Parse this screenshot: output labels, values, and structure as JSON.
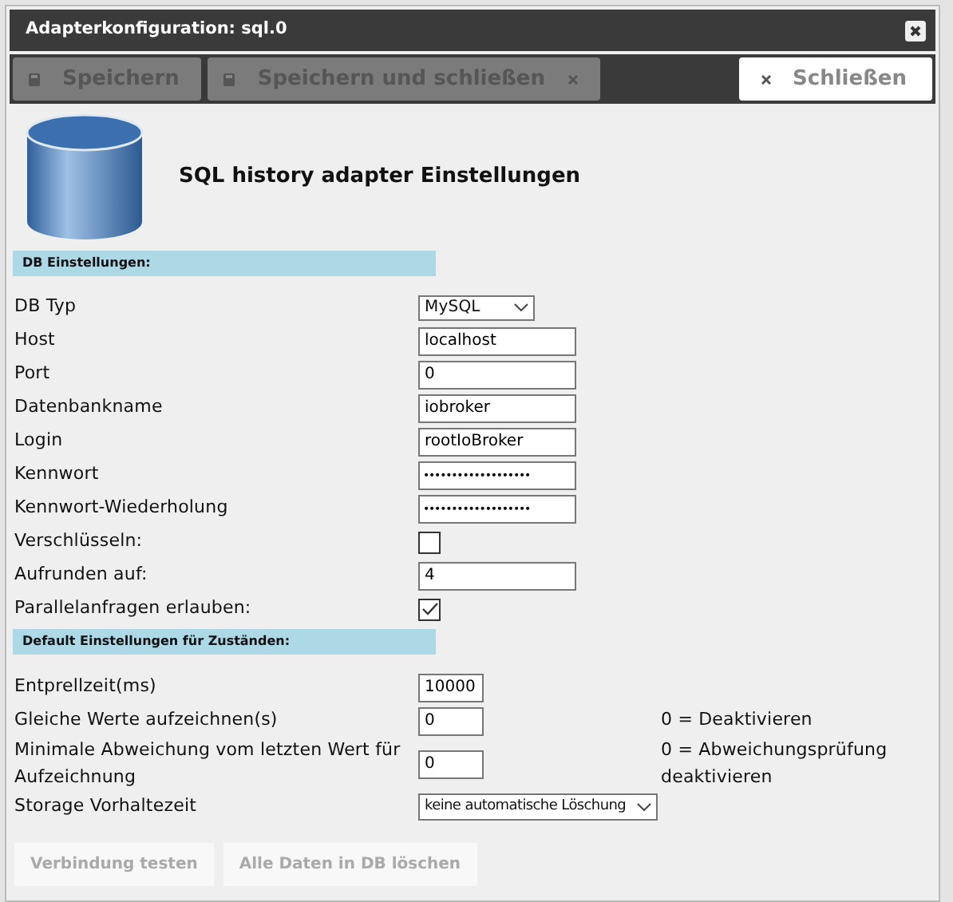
{
  "window": {
    "title": "Adapterkonfiguration: sql.0"
  },
  "toolbar": [
    {
      "label": "Speichern",
      "disabled": true
    },
    {
      "label": "Speichern und schließen",
      "disabled": true
    },
    {
      "label": "Schließen",
      "disabled": false
    }
  ],
  "heading": "SQL history adapter Einstellungen",
  "sections": [
    {
      "title": "DB Einstellungen:",
      "rows": [
        {
          "kind": "select",
          "label": "DB Typ",
          "value": "MySQL"
        },
        {
          "kind": "text",
          "label": "Host",
          "value": "localhost"
        },
        {
          "kind": "text",
          "label": "Port",
          "value": "0"
        },
        {
          "kind": "text",
          "label": "Datenbankname",
          "value": "iobroker"
        },
        {
          "kind": "text",
          "label": "Login",
          "value": "rootIoBroker"
        },
        {
          "kind": "secret",
          "label": "Kennwort",
          "value": "•••••••••••••••••••"
        },
        {
          "kind": "secret",
          "label": "Kennwort-Wiederholung",
          "value": "•••••••••••••••••••"
        },
        {
          "kind": "checkbox",
          "label": "Verschlüsseln:",
          "checked": false
        },
        {
          "kind": "text",
          "label": "Aufrunden auf:",
          "value": "4"
        },
        {
          "kind": "checkbox",
          "label": "Parallelanfragen erlauben:",
          "checked": true
        }
      ]
    },
    {
      "title": "Default Einstellungen für Zuständen:",
      "rows": [
        {
          "kind": "short",
          "label": "Entprellzeit(ms)",
          "value": "10000"
        },
        {
          "kind": "short",
          "label": "Gleiche Werte aufzeichnen(s)",
          "value": "0",
          "note": "0 = Deaktivieren"
        },
        {
          "kind": "short",
          "label": "Minimale Abweichung vom letzten Wert für Aufzeichnung",
          "value": "0",
          "note": "0 = Abweichungsprüfung deaktivieren"
        },
        {
          "kind": "wideselect",
          "label": "Storage Vorhaltezeit",
          "value": "keine automatische Löschung"
        }
      ]
    }
  ],
  "actions": [
    {
      "label": "Verbindung testen",
      "disabled": true
    },
    {
      "label": "Alle Daten in DB löschen",
      "disabled": true
    }
  ]
}
